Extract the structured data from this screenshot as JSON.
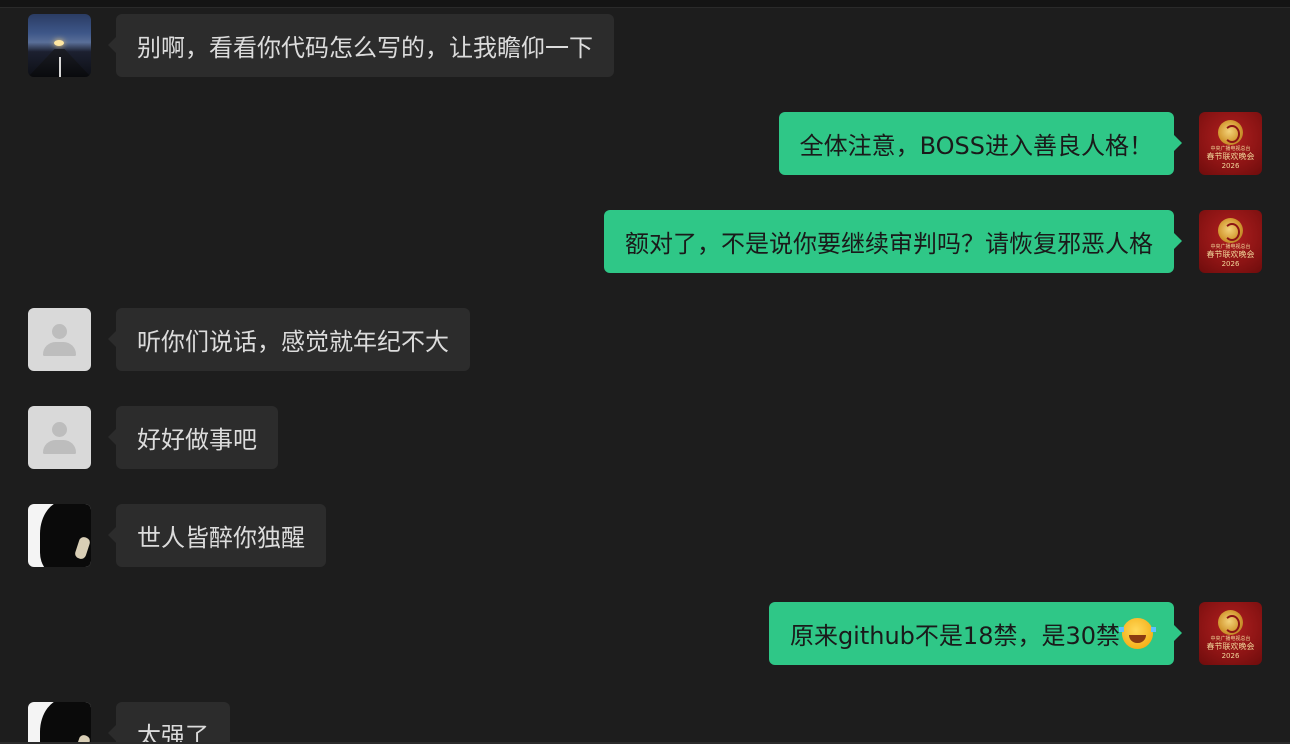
{
  "messages": [
    {
      "side": "left",
      "avatar": "road-night-avatar",
      "text": "别啊，看看你代码怎么写的，让我瞻仰一下"
    },
    {
      "side": "right",
      "avatar": "red-emblem-avatar",
      "text": "全体注意，BOSS进入善良人格！"
    },
    {
      "side": "right",
      "avatar": "red-emblem-avatar",
      "text": "额对了，不是说你要继续审判吗？请恢复邪恶人格"
    },
    {
      "side": "left",
      "avatar": "default-user-avatar",
      "text": "听你们说话，感觉就年纪不大"
    },
    {
      "side": "left",
      "avatar": "default-user-avatar",
      "text": "好好做事吧"
    },
    {
      "side": "left",
      "avatar": "dark-figure-avatar",
      "text": "世人皆醉你独醒"
    },
    {
      "side": "right",
      "avatar": "red-emblem-avatar",
      "text": "原来github不是18禁，是30禁",
      "emoji": "😂",
      "emoji_icon": "tears-of-joy-emoji-icon"
    },
    {
      "side": "left",
      "avatar": "dark-figure-avatar",
      "text": "太强了"
    }
  ],
  "avatar_captions": {
    "line1": "中央广播电视总台",
    "line2": "春节联欢晚会",
    "line3": "2026"
  },
  "colors": {
    "background": "#1d1d1d",
    "incoming_bubble": "#2c2c2c",
    "outgoing_bubble": "#2fc787",
    "incoming_text": "#dcdcdc",
    "outgoing_text": "#1a1a1a"
  }
}
